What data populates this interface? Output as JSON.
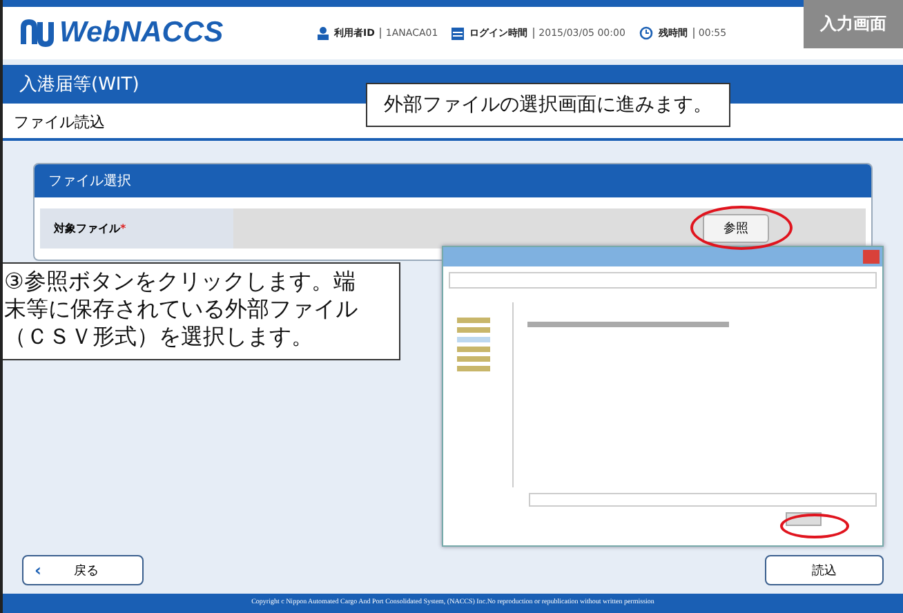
{
  "header": {
    "logo": "WebNACCS",
    "user_label": "利用者ID",
    "user_value": "1ANACA01",
    "login_label": "ログイン時間",
    "login_value": "2015/03/05 00:00",
    "remaining_label": "残時間",
    "remaining_value": "00:55"
  },
  "badge": "入力画面",
  "title_bar": "入港届等(WIT)",
  "page_heading": "ファイル読込",
  "panel": {
    "title": "ファイル選択",
    "field_label": "対象ファイル",
    "required_mark": "*",
    "browse_button": "参照"
  },
  "callouts": [
    "外部ファイルの選択画面に進みます。",
    "③参照ボタンをクリックします。端末等に保存されている外部ファイル（ＣＳＶ形式）を選択します。"
  ],
  "buttons": {
    "back": "戻る",
    "back_icon": "‹",
    "load": "読込"
  },
  "footer": "Copyright c Nippon Automated Cargo And Port Consolidated System, (NACCS) Inc.No reproduction or republication without written permission"
}
